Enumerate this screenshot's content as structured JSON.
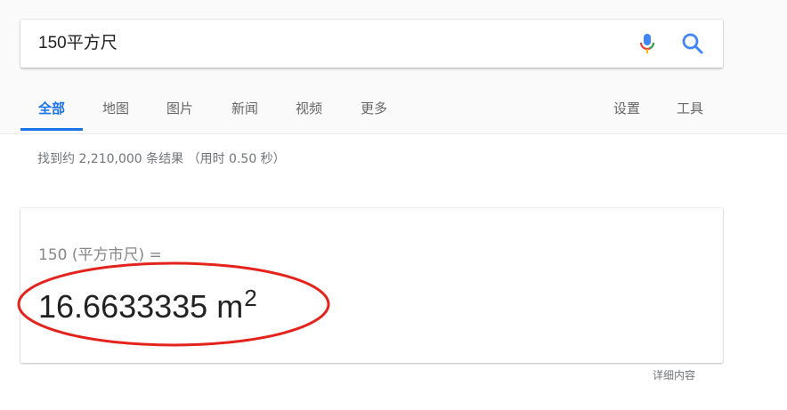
{
  "search": {
    "query": "150平方尺"
  },
  "icons": {
    "mic": "microphone-icon",
    "search": "search-icon"
  },
  "tabs": [
    {
      "label": "全部",
      "active": true
    },
    {
      "label": "地图"
    },
    {
      "label": "图片"
    },
    {
      "label": "新闻"
    },
    {
      "label": "视频"
    },
    {
      "label": "更多"
    }
  ],
  "tools": {
    "settings": "设置",
    "tools": "工具"
  },
  "stats": "找到约 2,210,000 条结果  （用时 0.50 秒）",
  "converter": {
    "from_text": "150 (平方市尺) =",
    "result_value": "16.6633335 m",
    "result_exponent": "2"
  },
  "details_link": "详细内容",
  "colors": {
    "accent": "#1a73e8",
    "annotation": "#e3231c",
    "mic_blue": "#4285f4",
    "mic_red": "#ea4335",
    "mic_yellow": "#fbbc05",
    "mic_green": "#34a853"
  }
}
